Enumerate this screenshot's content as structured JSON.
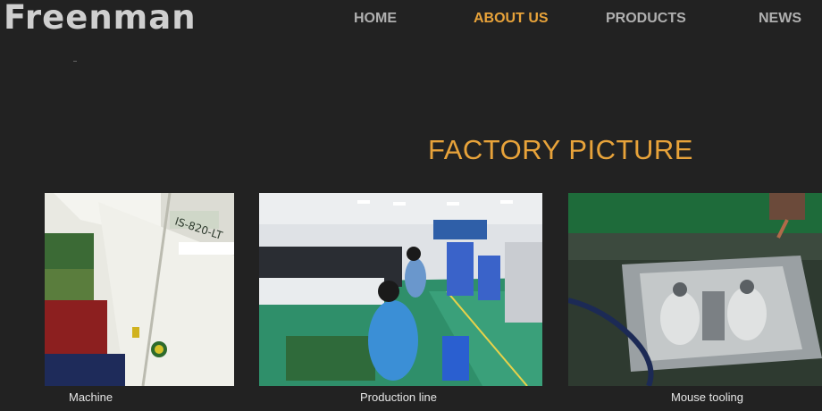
{
  "header": {
    "logo_text": "Freenman",
    "nav": [
      {
        "label": "HOME",
        "active": false
      },
      {
        "label": "ABOUT US",
        "active": true
      },
      {
        "label": "PRODUCTS",
        "active": false
      },
      {
        "label": "NEWS",
        "active": false
      }
    ]
  },
  "section": {
    "title": "FACTORY PICTURE",
    "gallery": [
      {
        "caption": "Machine",
        "photo": "reflow-machine-photo"
      },
      {
        "caption": "Production line",
        "photo": "production-line-photo"
      },
      {
        "caption": "Mouse tooling",
        "photo": "mouse-tooling-photo"
      }
    ]
  },
  "colors": {
    "background": "#222222",
    "accent": "#e8a33a",
    "nav_text": "#b0b0b0",
    "logo": "#cfcfcf",
    "caption": "#e6e6e6"
  }
}
